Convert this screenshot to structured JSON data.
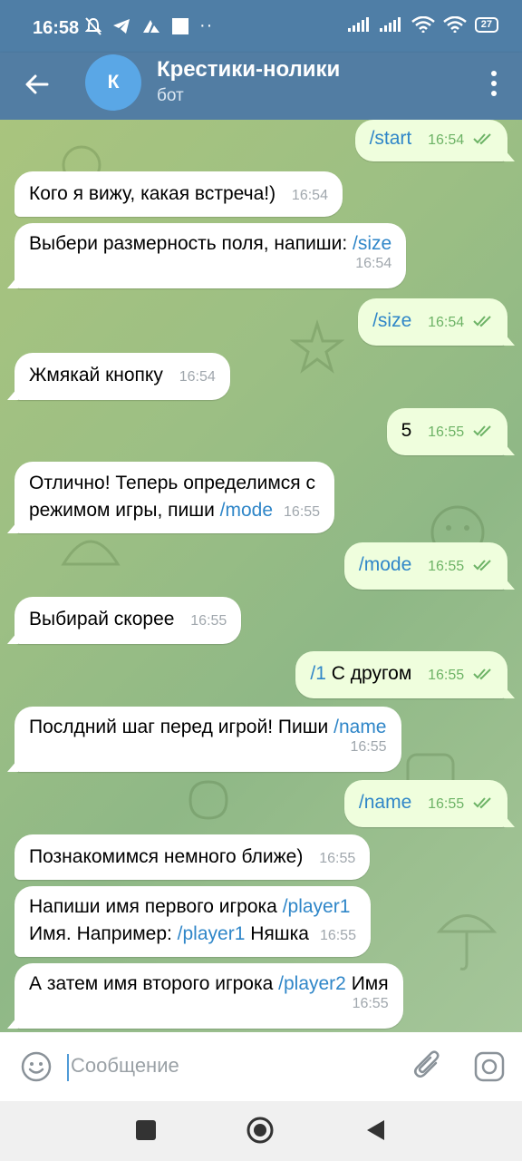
{
  "status_bar": {
    "time": "16:58",
    "battery": "27"
  },
  "header": {
    "avatar_letter": "К",
    "title": "Крестики-нолики",
    "subtitle": "бот"
  },
  "messages": [
    {
      "dir": "out",
      "text": "/start",
      "time": "16:54"
    },
    {
      "dir": "in",
      "text": "Кого я вижу, какая встреча!)",
      "time": "16:54"
    },
    {
      "dir": "in",
      "text": "Выбери размерность поля, напиши: ",
      "cmd": "/size",
      "time": "16:54"
    },
    {
      "dir": "out",
      "text": "/size",
      "time": "16:54"
    },
    {
      "dir": "in",
      "text": "Жмякай кнопку",
      "time": "16:54"
    },
    {
      "dir": "out",
      "text": "5",
      "time": "16:55"
    },
    {
      "dir": "in",
      "text_line1": "Отлично! Теперь определимся с",
      "text_line2": "режимом игры, пиши ",
      "cmd": "/mode",
      "time": "16:55"
    },
    {
      "dir": "out",
      "text": "/mode",
      "time": "16:55"
    },
    {
      "dir": "in",
      "text": "Выбирай скорее",
      "time": "16:55"
    },
    {
      "dir": "out",
      "cmd": "/1",
      "text": " С другом",
      "time": "16:55"
    },
    {
      "dir": "in",
      "text": "Послдний шаг перед игрой! Пиши ",
      "cmd": "/name",
      "time": "16:55"
    },
    {
      "dir": "out",
      "text": "/name",
      "time": "16:55"
    },
    {
      "dir": "in",
      "text": "Познакомимся немного ближе)",
      "time": "16:55"
    },
    {
      "dir": "in",
      "text_line1": "Напиши имя первого игрока ",
      "cmd1": "/player1",
      "text_line2": "Имя. Например: ",
      "cmd2": "/player1",
      "text_line2b": " Няшка",
      "time": "16:55"
    },
    {
      "dir": "in",
      "text": "А затем имя второго игрока ",
      "cmd": "/player2",
      "text_b": " Имя",
      "time": "16:55"
    }
  ],
  "input": {
    "placeholder": "Сообщение"
  },
  "colors": {
    "header": "#527da3",
    "command": "#2f86c8",
    "outgoing_bubble": "#effedd",
    "check": "#6db366"
  }
}
